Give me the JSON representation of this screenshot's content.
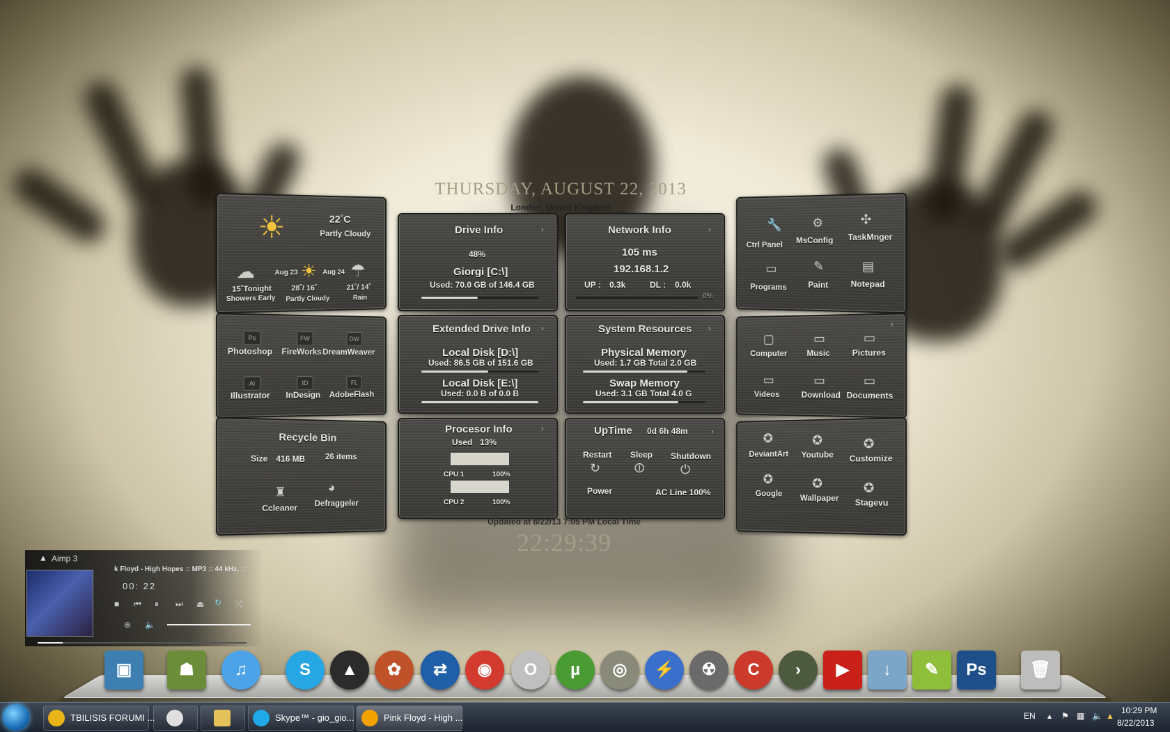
{
  "date": {
    "title": "Thursday, August 22, 2013",
    "location": "London, United Kingdom"
  },
  "weather": {
    "temp": "22˚C",
    "condition": "Partly Cloudy",
    "tonight": "15˚Tonight",
    "tonight_desc": "Showers Early",
    "day1_label": "Aug 23",
    "day1_temp": "28˚/ 16˚",
    "day1_desc": "Partly Cloudy",
    "day2_label": "Aug 24",
    "day2_temp": "21˚/ 14˚",
    "day2_desc": "Rain"
  },
  "drive": {
    "title": "Drive Info",
    "percent": "48%",
    "name": "Giorgi [C:\\]",
    "used": "Used: 70.0 GB of 146.4 GB",
    "fill": 0.48
  },
  "network": {
    "title": "Network Info",
    "ping": "105 ms",
    "ip": "192.168.1.2",
    "up_label": "UP :",
    "up": "0.3k",
    "dl_label": "DL :",
    "dl": "0.0k",
    "pct": "0%"
  },
  "launcher1": {
    "ctrl": "Ctrl Panel",
    "msconfig": "MsConfig",
    "task": "TaskMnger",
    "programs": "Programs",
    "paint": "Paint",
    "notepad": "Notepad"
  },
  "adobe": {
    "ps": "Photoshop",
    "fw": "FireWorks",
    "dw": "DreamWeaver",
    "ai": "Illustrator",
    "id": "InDesign",
    "fl": "AdobeFlash",
    "ps_g": "Ps",
    "fw_g": "FW",
    "dw_g": "DW",
    "ai_g": "Ai",
    "id_g": "ID",
    "fl_g": "FL"
  },
  "ext_drive": {
    "title": "Extended Drive Info",
    "d_name": "Local Disk [D:\\]",
    "d_used": "Used: 86.5 GB of 151.6 GB",
    "d_fill": 0.57,
    "e_name": "Local Disk [E:\\]",
    "e_used": "Used: 0.0 B of 0.0 B",
    "e_fill": 1.0
  },
  "sysres": {
    "title": "System Resources",
    "phys": "Physical Memory",
    "phys_used": "Used: 1.7 GB  Total  2.0 GB",
    "phys_fill": 0.85,
    "swap": "Swap Memory",
    "swap_used": "Used: 3.1 GB  Total 4.0 G",
    "swap_fill": 0.78
  },
  "folders": {
    "computer": "Computer",
    "music": "Music",
    "pictures": "Pictures",
    "videos": "Videos",
    "download": "Download",
    "documents": "Documents"
  },
  "recycle": {
    "title": "Recycle Bin",
    "size_label": "Size",
    "size": "416 MB",
    "items": "26 items",
    "ccleaner": "Ccleaner",
    "defrag": "Defraggeler"
  },
  "cpu": {
    "title": "Procesor Info",
    "used_label": "Used",
    "used": "13%",
    "cpu1": "CPU 1",
    "cpu1_val": "100%",
    "cpu2": "CPU 2",
    "cpu2_val": "100%"
  },
  "uptime": {
    "title": "UpTime",
    "value": "0d 6h 48m",
    "restart": "Restart",
    "sleep": "Sleep",
    "shutdown": "Shutdown",
    "power": "Power",
    "ac": "AC Line 100%"
  },
  "web": {
    "deviantart": "DeviantArt",
    "youtube": "Youtube",
    "customize": "Customize",
    "google": "Google",
    "wallpaper": "Wallpaper",
    "stagevu": "Stagevu"
  },
  "updated": "Updated at 8/22/13 7:05 PM Local Time",
  "clock": "22:29:39",
  "aimp": {
    "title": "Aimp 3",
    "track": "k Floyd - High Hopes :: MP3 :: 44 kHz, ::",
    "time": "00: 22",
    "progress": 0.12,
    "volume": 1.0
  },
  "taskbar": {
    "items": [
      {
        "label": "TBILISIS FORUMI ...",
        "color": "#e8b417"
      },
      {
        "label": "",
        "color": "#e0e0e0"
      },
      {
        "label": "",
        "color": "#e4c25a"
      },
      {
        "label": "Skype™ - gio_gio...",
        "color": "#20a9e8"
      },
      {
        "label": "Pink Floyd - High ...",
        "color": "#f2a100"
      }
    ],
    "lang": "EN",
    "time": "10:29 PM",
    "date": "8/22/2013"
  },
  "dock": {
    "icons": [
      {
        "name": "computer",
        "color": "#3d7fb0",
        "glyph": "▣"
      },
      {
        "name": "android",
        "color": "#6b8d3a",
        "glyph": "☗"
      },
      {
        "name": "itunes",
        "color": "#4da3e8",
        "glyph": "♫"
      },
      {
        "name": "skype",
        "color": "#26a6e3",
        "glyph": "S"
      },
      {
        "name": "aimp",
        "color": "#2b2b2b",
        "glyph": "▲"
      },
      {
        "name": "picasa",
        "color": "#c0522a",
        "glyph": "✿"
      },
      {
        "name": "teamviewer",
        "color": "#1e5fa8",
        "glyph": "⇄"
      },
      {
        "name": "chrome",
        "color": "#d43b2f",
        "glyph": "◉"
      },
      {
        "name": "opera",
        "color": "#bfbfbf",
        "glyph": "O"
      },
      {
        "name": "utorrent",
        "color": "#4a9b34",
        "glyph": "µ"
      },
      {
        "name": "dvd",
        "color": "#8a8a7a",
        "glyph": "◎"
      },
      {
        "name": "flashget",
        "color": "#3a6fcc",
        "glyph": "⚡"
      },
      {
        "name": "burner",
        "color": "#6a6a6a",
        "glyph": "☢"
      },
      {
        "name": "ccleaner",
        "color": "#cc3a2c",
        "glyph": "C"
      },
      {
        "name": "terminal",
        "color": "#4c5a3e",
        "glyph": "›"
      },
      {
        "name": "youtube",
        "color": "#c9201a",
        "glyph": "▶"
      },
      {
        "name": "downloads",
        "color": "#7ba6c8",
        "glyph": "↓"
      },
      {
        "name": "notes",
        "color": "#8fbf3a",
        "glyph": "✎"
      },
      {
        "name": "photoshop",
        "color": "#1f4f8a",
        "glyph": "Ps"
      },
      {
        "name": "trash",
        "color": "#bdbdbd",
        "glyph": "🗑"
      }
    ]
  }
}
